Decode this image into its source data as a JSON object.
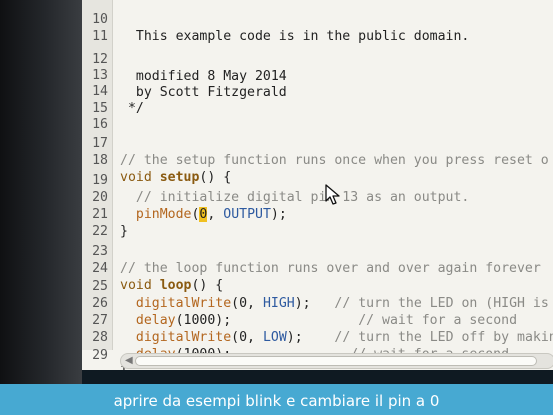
{
  "editor": {
    "lines": [
      {
        "num": "10",
        "text": "  This example code is in the public domain."
      },
      {
        "num": "11",
        "text": ""
      },
      {
        "num": "12",
        "text": "  modified 8 May 2014"
      },
      {
        "num": "13",
        "text": "  by Scott Fitzgerald"
      },
      {
        "num": "14",
        "text": " */"
      },
      {
        "num": "15",
        "text": ""
      },
      {
        "num": "16",
        "text": ""
      },
      {
        "num": "17",
        "text": "// the setup function runs once when you press reset o"
      },
      {
        "num": "18",
        "kw": "void ",
        "fn": "setup",
        "rest": "() {"
      },
      {
        "num": "19",
        "text": "  // initialize digital pin 13 as an output."
      },
      {
        "num": "20",
        "pre": "  ",
        "fn2": "pinMode",
        "p1": "(",
        "hl": "0",
        "p2": ", ",
        "cst": "OUTPUT",
        "p3": ");"
      },
      {
        "num": "21",
        "text": "}"
      },
      {
        "num": "22",
        "text": ""
      },
      {
        "num": "23",
        "text": "// the loop function runs over and over again forever"
      },
      {
        "num": "24",
        "kw": "void ",
        "fn": "loop",
        "rest": "() {"
      },
      {
        "num": "25",
        "pre": "  ",
        "fn2": "digitalWrite",
        "args": "(0, ",
        "cst": "HIGH",
        "close": ");",
        "pad": "   ",
        "cm": "// turn the LED on (HIGH is"
      },
      {
        "num": "26",
        "pre": "  ",
        "fn2": "delay",
        "args": "(1000);",
        "pad": "                ",
        "cm": "// wait for a second"
      },
      {
        "num": "27",
        "pre": "  ",
        "fn2": "digitalWrite",
        "args": "(0, ",
        "cst": "LOW",
        "close": ");",
        "pad": "    ",
        "cm": "// turn the LED off by makin"
      },
      {
        "num": "28",
        "pre": "  ",
        "fn2": "delay",
        "args": "(1000);",
        "pad": "               ",
        "cm": "// wait for a second"
      },
      {
        "num": "29",
        "text": "}"
      }
    ]
  },
  "caption": "aprire da esempi blink e cambiare il pin a 0",
  "colors": {
    "caption_bar": "#47a9d2",
    "keyword": "#8a5a10",
    "constant": "#2e5aa0",
    "comment": "#8a8a86",
    "highlight": "#f0c020"
  }
}
